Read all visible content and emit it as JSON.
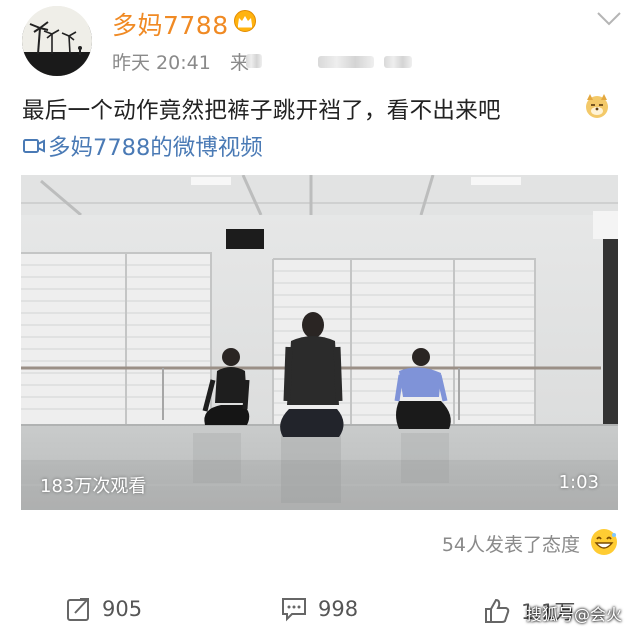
{
  "header": {
    "username": "多妈7788",
    "time": "昨天 20:41",
    "source_prefix": "来"
  },
  "post": {
    "text": "最后一个动作竟然把裤子跳开裆了，看不出来吧",
    "video_link": "多妈7788的微博视频"
  },
  "video": {
    "views": "183万次观看",
    "duration": "1:03"
  },
  "reactions": {
    "text": "54人发表了态度"
  },
  "actions": {
    "repost_count": "905",
    "comment_count": "998",
    "like_count": "1.1万"
  },
  "watermark": {
    "text": "搜狐号@会火"
  },
  "colors": {
    "username": "#f08a24",
    "link": "#4a7ab5",
    "meta": "#8a8a8a"
  }
}
